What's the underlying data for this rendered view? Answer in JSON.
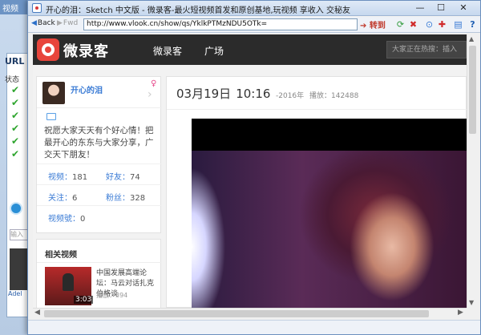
{
  "background_app": {
    "title": "视频",
    "url_label": "URL",
    "status_label": "状态",
    "check_icon": "✔",
    "check_count": 6,
    "search_placeholder": "输入",
    "thumb_label": "Adel"
  },
  "window": {
    "title": "开心的泪：Sketch 中文版 - 微录客-最火短视频首发和原创基地,玩视频 享收入 交秘友",
    "minimize": "—",
    "maximize": "☐",
    "close": "✕"
  },
  "toolbar": {
    "back_label": "Back",
    "fwd_label": "Fwd",
    "url": "http://www.vlook.cn/show/qs/YklkPTMzNDU5OTk=",
    "go_label": "转到"
  },
  "site": {
    "logo": "微录客",
    "nav": [
      "微录客",
      "广场"
    ],
    "search_placeholder": "大家正在热搜：插入"
  },
  "profile": {
    "name": "开心的泪",
    "gender_icon": "♀",
    "chevron": "›",
    "bio": "祝愿大家天天有个好心情！把最开心的东东与大家分享，广交天下朋友！",
    "stats": [
      {
        "label": "视频：",
        "value": "181"
      },
      {
        "label": "好友：",
        "value": "74"
      },
      {
        "label": "关注：",
        "value": "6"
      },
      {
        "label": "粉丝：",
        "value": "328"
      },
      {
        "label": "视频號：",
        "value": "0"
      }
    ]
  },
  "related": {
    "title": "相关视频",
    "item": {
      "text": "中国发展高端论坛：马云对话扎克伯格谈",
      "duration": "3:03",
      "plays": "播放：394"
    }
  },
  "post": {
    "date": "03月19日",
    "time": "10:16",
    "year": "-2016年",
    "plays": "播放：142488"
  },
  "colors": {
    "header_bg": "#2b2b2b",
    "logo_red": "#e8453c",
    "link_blue": "#3a7bd5"
  }
}
